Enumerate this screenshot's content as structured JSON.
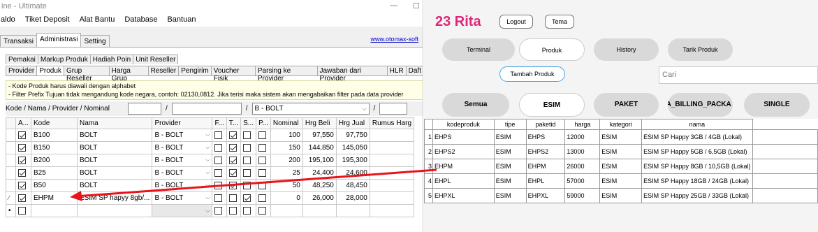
{
  "left_window": {
    "title": "ine - Ultimate",
    "menu": [
      "aldo",
      "Tiket Deposit",
      "Alat Bantu",
      "Database",
      "Bantuan"
    ],
    "top_tabs": [
      "Transaksi",
      "Administrasi",
      "Setting"
    ],
    "website": "www.otomax-soft",
    "sub_tabs_row1": [
      "Pemakai",
      "Markup Produk",
      "Hadiah Poin",
      "Unit Reseller"
    ],
    "sub_tabs_row2": [
      "Provider",
      "Produk",
      "Grup Reseller",
      "Harga Grup",
      "Reseller",
      "Pengirim",
      "Voucher Fisik",
      "Parsing ke Provider",
      "Jawaban dari Provider",
      "HLR",
      "Daft"
    ],
    "info_line1": "- Kode Produk harus diawali dengan alphabet",
    "info_line2": "- Filter Prefix Tujuan tidak mengandung kode negara, contoh: 02130,0812. Jika terisi maka sistem akan mengabaikan filter pada data provider",
    "filter_label": "Kode / Nama / Provider / Nominal",
    "filter_sep": "/",
    "filter_provider": "B - BOLT",
    "columns": [
      "A...",
      "Kode",
      "Nama",
      "Provider",
      "F...",
      "T...",
      "S...",
      "P...",
      "Nominal",
      "Hrg Beli",
      "Hrg Jual",
      "Rumus Harg"
    ],
    "rows": [
      {
        "kode": "B100",
        "nama": "BOLT",
        "provider": "B - BOLT",
        "nominal": "100",
        "beli": "97,550",
        "jual": "97,750"
      },
      {
        "kode": "B150",
        "nama": "BOLT",
        "provider": "B - BOLT",
        "nominal": "150",
        "beli": "144,850",
        "jual": "145,050"
      },
      {
        "kode": "B200",
        "nama": "BOLT",
        "provider": "B - BOLT",
        "nominal": "200",
        "beli": "195,100",
        "jual": "195,300"
      },
      {
        "kode": "B25",
        "nama": "BOLT",
        "provider": "B - BOLT",
        "nominal": "25",
        "beli": "24,400",
        "jual": "24,600"
      },
      {
        "kode": "B50",
        "nama": "BOLT",
        "provider": "B - BOLT",
        "nominal": "50",
        "beli": "48,250",
        "jual": "48,450"
      },
      {
        "kode": "EHPM",
        "nama": "ESIM SP hapyy 8gb/...",
        "provider": "B - BOLT",
        "nominal": "0",
        "beli": "26,000",
        "jual": "28,000"
      }
    ]
  },
  "right_app": {
    "title": "23 Rita",
    "logout": "Logout",
    "tema": "Tema",
    "nav": [
      "Terminal",
      "Produk",
      "History",
      "Tarik Produk"
    ],
    "tambah": "Tambah Produk",
    "search_placeholder": "Cari",
    "categories": [
      "Semua",
      "ESIM",
      "PAKET",
      "TA_BILLING_PACKA",
      "SINGLE"
    ],
    "columns": [
      "kodeproduk",
      "tipe",
      "paketid",
      "harga",
      "kategori",
      "nama"
    ],
    "rows": [
      {
        "no": "1",
        "kode": "EHPS",
        "tipe": "ESIM",
        "paket": "EHPS",
        "harga": "12000",
        "kategori": "ESIM",
        "nama": "ESIM SP Happy 3GB / 4GB (Lokal)"
      },
      {
        "no": "2",
        "kode": "EHPS2",
        "tipe": "ESIM",
        "paket": "EHPS2",
        "harga": "13000",
        "kategori": "ESIM",
        "nama": "ESIM SP Happy 5GB / 6,5GB (Lokal)"
      },
      {
        "no": "3",
        "kode": "EHPM",
        "tipe": "ESIM",
        "paket": "EHPM",
        "harga": "26000",
        "kategori": "ESIM",
        "nama": "ESIM SP Happy 8GB / 10,5GB (Lokal)"
      },
      {
        "no": "4",
        "kode": "EHPL",
        "tipe": "ESIM",
        "paket": "EHPL",
        "harga": "57000",
        "kategori": "ESIM",
        "nama": "ESIM SP Happy 18GB / 24GB (Lokal)"
      },
      {
        "no": "5",
        "kode": "EHPXL",
        "tipe": "ESIM",
        "paket": "EHPXL",
        "harga": "59000",
        "kategori": "ESIM",
        "nama": "ESIM SP Happy 25GB / 33GB (Lokal)"
      }
    ]
  },
  "colors": {
    "accent_title": "#e0267a",
    "arrow": "#e8141a"
  }
}
